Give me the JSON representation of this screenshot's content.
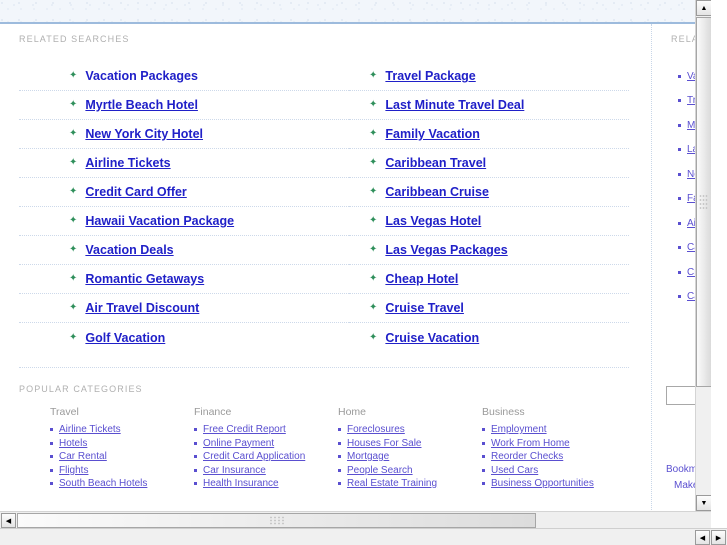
{
  "sections": {
    "related_searches_heading": "RELATED SEARCHES",
    "popular_categories_heading": "POPULAR CATEGORIES",
    "sidebar_heading": "RELATED"
  },
  "related_searches": {
    "arrow_icon": "✦",
    "left_column": [
      "Vacation Packages",
      "Myrtle Beach Hotel",
      "New York City Hotel",
      "Airline Tickets",
      "Credit Card Offer",
      "Hawaii Vacation Package",
      "Vacation Deals",
      "Romantic Getaways",
      "Air Travel Discount",
      "Golf Vacation"
    ],
    "right_column": [
      "Travel Package",
      "Last Minute Travel Deal",
      "Family Vacation",
      "Caribbean Travel",
      "Caribbean Cruise",
      "Las Vegas Hotel",
      "Las Vegas Packages",
      "Cheap Hotel",
      "Cruise Travel",
      "Cruise Vacation"
    ]
  },
  "popular_categories": [
    {
      "title": "Travel",
      "items": [
        "Airline Tickets",
        "Hotels",
        "Car Rental",
        "Flights",
        "South Beach Hotels"
      ]
    },
    {
      "title": "Finance",
      "items": [
        "Free Credit Report",
        "Online Payment",
        "Credit Card Application",
        "Car Insurance",
        "Health Insurance"
      ]
    },
    {
      "title": "Home",
      "items": [
        "Foreclosures",
        "Houses For Sale",
        "Mortgage",
        "People Search",
        "Real Estate Training"
      ]
    },
    {
      "title": "Business",
      "items": [
        "Employment",
        "Work From Home",
        "Reorder Checks",
        "Used Cars",
        "Business Opportunities"
      ]
    }
  ],
  "sidebar": {
    "links": [
      "Va",
      "Tr",
      "My",
      "La",
      "Ne",
      "Fa",
      "Air",
      "Ca",
      "Cre",
      "Ca"
    ],
    "search_value": "",
    "search_placeholder": "",
    "bookmark_label": "Bookmark",
    "make_home_label": "Make this"
  },
  "scrollbars": {
    "up_arrow": "▲",
    "down_arrow": "▼",
    "left_arrow": "◀",
    "right_arrow": "▶"
  },
  "colors": {
    "link_blue": "#2020c8",
    "link_purple": "#5a4fd0",
    "arrow_green": "#2f8f5b",
    "heading_gray": "#b0b0b0",
    "band_border": "#9dbbdd"
  }
}
